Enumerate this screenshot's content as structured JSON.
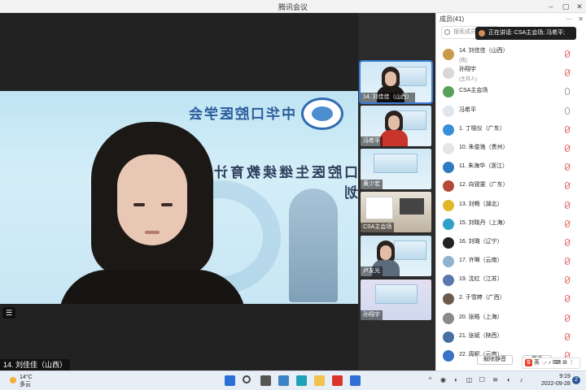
{
  "window": {
    "title": "腾讯会议"
  },
  "main_video": {
    "banner_title": "中华口腔医学会",
    "banner_subtitle": "口腔医生继续教育计划",
    "name_label": "14. 刘佳佳（山西）"
  },
  "thumbnails": [
    {
      "label": "14. 刘佳佳（山西）",
      "active": true
    },
    {
      "label": "冯希平"
    },
    {
      "label": "黄少宏"
    },
    {
      "label": "CSA主会场"
    },
    {
      "label": "卢友光"
    },
    {
      "label": "孙翔宇"
    }
  ],
  "panel": {
    "title": "成员(41)",
    "more_icon": "⋯",
    "close_icon": "✕",
    "search_placeholder": "搜索成员",
    "speaking_text": "正在讲话: CSA主会场; 冯希平;",
    "participants": [
      {
        "name": "14. 刘佳佳（山西）",
        "sub": "(我)",
        "mic": "muted",
        "avatar": "#c99a4a"
      },
      {
        "name": "孙翔宇",
        "sub": "(主持人)",
        "mic": "muted",
        "avatar": "#d8d8d8"
      },
      {
        "name": "CSA主会场",
        "sub": "",
        "mic": "on",
        "avatar": "#5aa05a"
      },
      {
        "name": "冯希平",
        "sub": "",
        "mic": "on",
        "avatar": "#dfe6ee"
      },
      {
        "name": "1. 丁晓仪（广东）",
        "sub": "",
        "mic": "muted",
        "avatar": "#3a8fd8"
      },
      {
        "name": "10. 朱俊逸（贵州）",
        "sub": "",
        "mic": "muted",
        "avatar": "#e6e6e6"
      },
      {
        "name": "11. 朱海华（浙江）",
        "sub": "",
        "mic": "muted",
        "avatar": "#2e7bc4"
      },
      {
        "name": "12. 向锐雯（广东）",
        "sub": "",
        "mic": "muted",
        "avatar": "#b44a3a"
      },
      {
        "name": "13. 刘畅（湖北）",
        "sub": "",
        "mic": "muted",
        "avatar": "#e3b62a"
      },
      {
        "name": "15. 刘晓丹（上海）",
        "sub": "",
        "mic": "muted",
        "avatar": "#2ea1c9"
      },
      {
        "name": "16. 刘璐（辽宁）",
        "sub": "",
        "mic": "muted",
        "avatar": "#222222"
      },
      {
        "name": "17. 许琳（云南）",
        "sub": "",
        "mic": "muted",
        "avatar": "#8fb3cf"
      },
      {
        "name": "19. 沈红（江苏）",
        "sub": "",
        "mic": "muted",
        "avatar": "#5a78b0"
      },
      {
        "name": "2. 于雪婷（广西）",
        "sub": "",
        "mic": "muted",
        "avatar": "#6c5a4c"
      },
      {
        "name": "20. 张皓（上海）",
        "sub": "",
        "mic": "muted",
        "avatar": "#8a8a8a"
      },
      {
        "name": "21. 张斌（陕西）",
        "sub": "",
        "mic": "muted",
        "avatar": "#4a6fa5"
      },
      {
        "name": "22. 周昵（云南）",
        "sub": "",
        "mic": "muted",
        "avatar": "#3a72c7"
      }
    ],
    "mute_all_label": "解除静音",
    "more_label": "更多"
  },
  "ime": {
    "logo": "S",
    "text": "英 ·,◦ ♪ ⌨ ⊞ ⋮"
  },
  "taskbar": {
    "weather_temp": "14°C",
    "weather_desc": "多云",
    "time": "9:19",
    "date": "2022-09-28",
    "notif_count": "2",
    "apps": [
      {
        "name": "start-icon",
        "color": "#2b6fd6"
      },
      {
        "name": "search-icon",
        "color": "#444444"
      },
      {
        "name": "task-view-icon",
        "color": "#555555"
      },
      {
        "name": "mail-icon",
        "color": "#3b82c4"
      },
      {
        "name": "edge-icon",
        "color": "#1fa2b8"
      },
      {
        "name": "folder-icon",
        "color": "#f2c14e"
      },
      {
        "name": "wps-icon",
        "color": "#d9352a"
      },
      {
        "name": "tencent-meeting-icon",
        "color": "#2f6fd8"
      }
    ],
    "tray": [
      "^",
      "◉",
      "◐",
      "◫",
      "☐",
      "≋",
      "◖",
      "♪"
    ]
  }
}
